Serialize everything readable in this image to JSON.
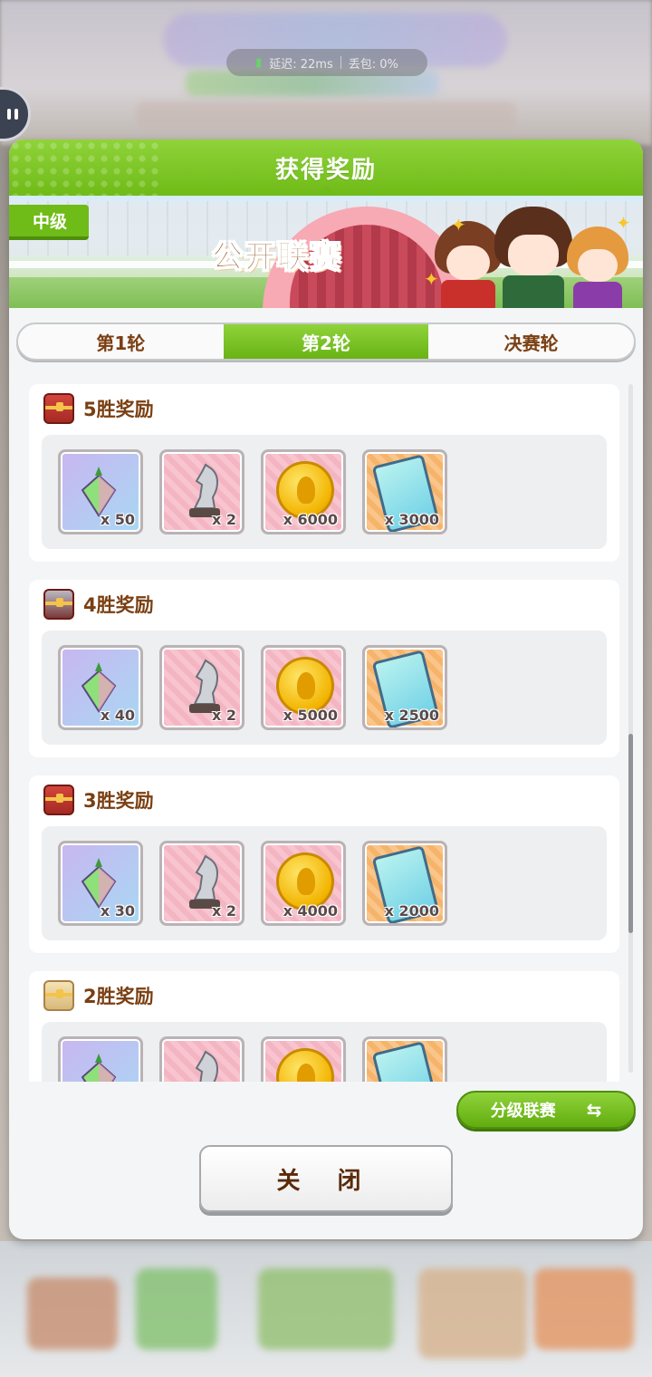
{
  "overlay": {
    "latency_label": "延迟: 22ms",
    "loss_label": "丢包: 0%"
  },
  "modal": {
    "title": "获得奖励",
    "tier_badge": "中级",
    "event_name": "公开联赛",
    "tabs": [
      {
        "label": "第1轮",
        "active": false
      },
      {
        "label": "第2轮",
        "active": true
      },
      {
        "label": "决赛轮",
        "active": false
      }
    ],
    "reward_groups": [
      {
        "title": "5胜奖励",
        "items": [
          {
            "kind": "carrot-crystal-icon",
            "qty": "x 50"
          },
          {
            "kind": "horse-statue-icon",
            "qty": "x 2"
          },
          {
            "kind": "gold-coin-icon",
            "qty": "x 6000"
          },
          {
            "kind": "ticket-icon",
            "qty": "x 3000"
          }
        ]
      },
      {
        "title": "4胜奖励",
        "items": [
          {
            "kind": "carrot-crystal-icon",
            "qty": "x 40"
          },
          {
            "kind": "horse-statue-icon",
            "qty": "x 2"
          },
          {
            "kind": "gold-coin-icon",
            "qty": "x 5000"
          },
          {
            "kind": "ticket-icon",
            "qty": "x 2500"
          }
        ]
      },
      {
        "title": "3胜奖励",
        "items": [
          {
            "kind": "carrot-crystal-icon",
            "qty": "x 30"
          },
          {
            "kind": "horse-statue-icon",
            "qty": "x 2"
          },
          {
            "kind": "gold-coin-icon",
            "qty": "x 4000"
          },
          {
            "kind": "ticket-icon",
            "qty": "x 2000"
          }
        ]
      },
      {
        "title": "2胜奖励",
        "items": [
          {
            "kind": "carrot-crystal-icon",
            "qty": ""
          },
          {
            "kind": "horse-statue-icon",
            "qty": ""
          },
          {
            "kind": "gold-coin-icon",
            "qty": ""
          },
          {
            "kind": "ticket-icon",
            "qty": ""
          }
        ]
      }
    ],
    "league_switch_label": "分级联赛",
    "close_label": "关 闭"
  },
  "colors": {
    "accent_green": "#6fbb17",
    "title_brown": "#7a3f12"
  }
}
